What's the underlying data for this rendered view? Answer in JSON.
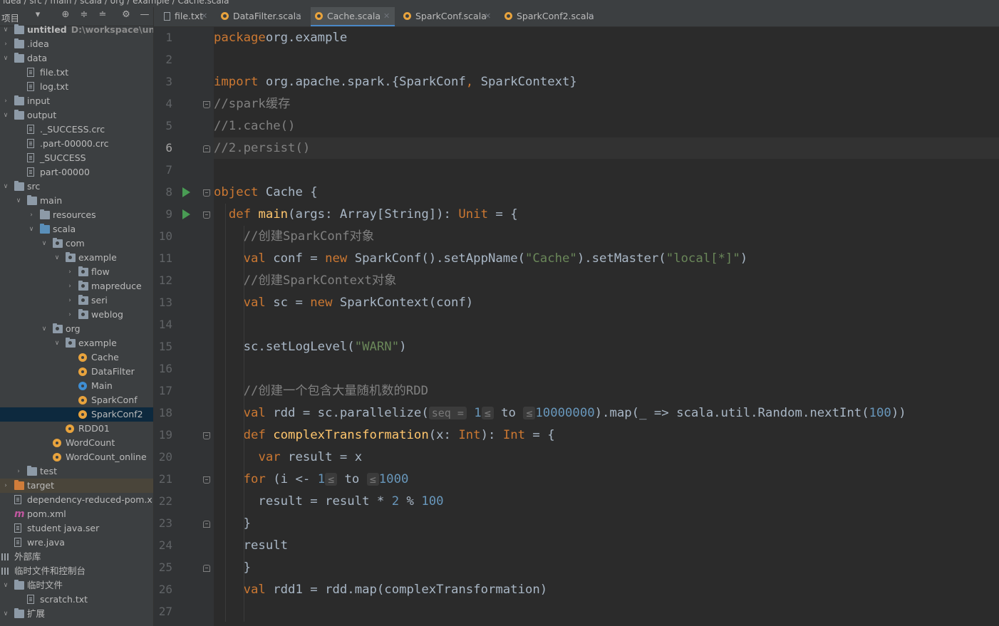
{
  "breadcrumb": "idea / src / main / scala / org / example / Cache.scala",
  "project_panel": {
    "title": "项目",
    "tree": [
      {
        "label": "untitled",
        "sub": "D:\\workspace\\untitled",
        "depth": 0,
        "arrow": "down",
        "icon": "folder",
        "bold": true
      },
      {
        "label": ".idea",
        "depth": 0,
        "arrow": "right",
        "icon": "folder"
      },
      {
        "label": "data",
        "depth": 0,
        "arrow": "down",
        "icon": "folder"
      },
      {
        "label": "file.txt",
        "depth": 1,
        "icon": "file"
      },
      {
        "label": "log.txt",
        "depth": 1,
        "icon": "file"
      },
      {
        "label": "input",
        "depth": 0,
        "arrow": "right",
        "icon": "folder"
      },
      {
        "label": "output",
        "depth": 0,
        "arrow": "down",
        "icon": "folder"
      },
      {
        "label": "._SUCCESS.crc",
        "depth": 1,
        "icon": "file"
      },
      {
        "label": ".part-00000.crc",
        "depth": 1,
        "icon": "file"
      },
      {
        "label": "_SUCCESS",
        "depth": 1,
        "icon": "file"
      },
      {
        "label": "part-00000",
        "depth": 1,
        "icon": "file"
      },
      {
        "label": "src",
        "depth": 0,
        "arrow": "down",
        "icon": "folder"
      },
      {
        "label": "main",
        "depth": 1,
        "arrow": "down",
        "icon": "folder"
      },
      {
        "label": "resources",
        "depth": 2,
        "arrow": "right",
        "icon": "folder"
      },
      {
        "label": "scala",
        "depth": 2,
        "arrow": "down",
        "icon": "folder-blue"
      },
      {
        "label": "com",
        "depth": 3,
        "arrow": "down",
        "icon": "package"
      },
      {
        "label": "example",
        "depth": 4,
        "arrow": "down",
        "icon": "package"
      },
      {
        "label": "flow",
        "depth": 5,
        "arrow": "right",
        "icon": "package"
      },
      {
        "label": "mapreduce",
        "depth": 5,
        "arrow": "right",
        "icon": "package"
      },
      {
        "label": "seri",
        "depth": 5,
        "arrow": "right",
        "icon": "package"
      },
      {
        "label": "weblog",
        "depth": 5,
        "arrow": "right",
        "icon": "package"
      },
      {
        "label": "org",
        "depth": 3,
        "arrow": "down",
        "icon": "package"
      },
      {
        "label": "example",
        "depth": 4,
        "arrow": "down",
        "icon": "package"
      },
      {
        "label": "Cache",
        "depth": 5,
        "icon": "scala-object"
      },
      {
        "label": "DataFilter",
        "depth": 5,
        "icon": "scala-object"
      },
      {
        "label": "Main",
        "depth": 5,
        "icon": "scala-class"
      },
      {
        "label": "SparkConf",
        "depth": 5,
        "icon": "scala-object"
      },
      {
        "label": "SparkConf2",
        "depth": 5,
        "icon": "scala-object",
        "selected": true
      },
      {
        "label": "RDD01",
        "depth": 4,
        "icon": "scala-object"
      },
      {
        "label": "WordCount",
        "depth": 3,
        "icon": "scala-object"
      },
      {
        "label": "WordCount_online",
        "depth": 3,
        "icon": "scala-object"
      },
      {
        "label": "test",
        "depth": 1,
        "arrow": "right",
        "icon": "folder"
      },
      {
        "label": "target",
        "depth": 0,
        "arrow": "right",
        "icon": "folder-orange",
        "highlight": true
      },
      {
        "label": "dependency-reduced-pom.xml",
        "depth": 0,
        "icon": "xml"
      },
      {
        "label": "pom.xml",
        "depth": 0,
        "icon": "maven"
      },
      {
        "label": "student java.ser",
        "depth": 0,
        "icon": "file"
      },
      {
        "label": "wre.java",
        "depth": 0,
        "icon": "file"
      },
      {
        "label": "外部库",
        "depth": -1,
        "icon": "library"
      },
      {
        "label": "临时文件和控制台",
        "depth": -1,
        "icon": "scratch"
      },
      {
        "label": "临时文件",
        "depth": 0,
        "arrow": "down",
        "icon": "folder"
      },
      {
        "label": "scratch.txt",
        "depth": 1,
        "icon": "file"
      },
      {
        "label": "扩展",
        "depth": 0,
        "arrow": "down",
        "icon": "folder"
      }
    ]
  },
  "tabs": [
    {
      "label": "file.txt",
      "icon": "file",
      "active": false
    },
    {
      "label": "DataFilter.scala",
      "icon": "scala",
      "active": false
    },
    {
      "label": "Cache.scala",
      "icon": "scala",
      "active": true
    },
    {
      "label": "SparkConf.scala",
      "icon": "scala",
      "active": false
    },
    {
      "label": "SparkConf2.scala",
      "icon": "scala",
      "active": false
    }
  ],
  "editor": {
    "current_line": 6,
    "lines": [
      [
        [
          "kw",
          "package"
        ],
        [
          "",
          "org.example"
        ]
      ],
      [],
      [
        [
          "kw",
          "import"
        ],
        [
          "",
          " org.apache.spark.{SparkConf"
        ],
        [
          "kw",
          ","
        ],
        [
          "",
          " SparkContext}"
        ]
      ],
      [
        [
          "cm",
          "//spark缓存"
        ]
      ],
      [
        [
          "cm",
          "//1.cache()"
        ]
      ],
      [
        [
          "cm",
          "//2.persist()"
        ]
      ],
      [],
      [
        [
          "kw",
          "object"
        ],
        [
          "",
          " Cache {"
        ]
      ],
      [
        [
          "",
          "  "
        ],
        [
          "kw",
          "def"
        ],
        [
          "",
          " "
        ],
        [
          "fn",
          "main"
        ],
        [
          "",
          "(args: Array[String]): "
        ],
        [
          "ty",
          "Unit"
        ],
        [
          "",
          " = {"
        ]
      ],
      [
        [
          "",
          "    "
        ],
        [
          "cm",
          "//创建SparkConf对象"
        ]
      ],
      [
        [
          "",
          "    "
        ],
        [
          "kw",
          "val"
        ],
        [
          "",
          " conf = "
        ],
        [
          "kw",
          "new"
        ],
        [
          "",
          " SparkConf().setAppName("
        ],
        [
          "str",
          "\"Cache\""
        ],
        [
          "",
          ").setMaster("
        ],
        [
          "str",
          "\"local[*]\""
        ],
        [
          "",
          ")"
        ]
      ],
      [
        [
          "",
          "    "
        ],
        [
          "cm",
          "//创建SparkContext对象"
        ]
      ],
      [
        [
          "",
          "    "
        ],
        [
          "kw",
          "val"
        ],
        [
          "",
          " sc = "
        ],
        [
          "kw",
          "new"
        ],
        [
          "",
          " SparkContext(conf)"
        ]
      ],
      [],
      [
        [
          "",
          "    sc.setLogLevel("
        ],
        [
          "str",
          "\"WARN\""
        ],
        [
          "",
          ")"
        ]
      ],
      [],
      [
        [
          "",
          "    "
        ],
        [
          "cm",
          "//创建一个包含大量随机数的RDD"
        ]
      ],
      [
        [
          "",
          "    "
        ],
        [
          "kw",
          "val"
        ],
        [
          "",
          " rdd = sc.parallelize("
        ],
        [
          "hint",
          "seq ="
        ],
        [
          "num",
          " 1"
        ],
        [
          "hint",
          "≤"
        ],
        [
          "",
          " to "
        ],
        [
          "hint",
          "≤"
        ],
        [
          "num",
          "10000000"
        ],
        [
          "",
          ").map(_ => scala.util.Random.nextInt("
        ],
        [
          "num",
          "100"
        ],
        [
          "",
          "))"
        ]
      ],
      [
        [
          "",
          "    "
        ],
        [
          "kw",
          "def"
        ],
        [
          "",
          " "
        ],
        [
          "fn",
          "complexTransformation"
        ],
        [
          "",
          "(x: "
        ],
        [
          "ty",
          "Int"
        ],
        [
          "",
          "): "
        ],
        [
          "ty",
          "Int"
        ],
        [
          "",
          " = {"
        ]
      ],
      [
        [
          "",
          "      "
        ],
        [
          "kw",
          "var"
        ],
        [
          "",
          " result = x"
        ]
      ],
      [
        [
          "",
          "    "
        ],
        [
          "kw",
          "for"
        ],
        [
          "",
          " (i <- "
        ],
        [
          "num",
          "1"
        ],
        [
          "hint",
          "≤"
        ],
        [
          "",
          " to "
        ],
        [
          "hint",
          "≤"
        ],
        [
          "num",
          "1000"
        ],
        [
          ") {"
        ]
      ],
      [
        [
          "",
          "      result = result * "
        ],
        [
          "num",
          "2"
        ],
        [
          "",
          " % "
        ],
        [
          "num",
          "100"
        ]
      ],
      [
        [
          "",
          "    }"
        ]
      ],
      [
        [
          "",
          "    result"
        ]
      ],
      [
        [
          "",
          "    }"
        ]
      ],
      [
        [
          "",
          "    "
        ],
        [
          "kw",
          "val"
        ],
        [
          "",
          " rdd1 = rdd.map(complexTransformation)"
        ]
      ],
      []
    ]
  },
  "gutter": {
    "run_lines": [
      8,
      9
    ],
    "fold_open_lines": [
      4,
      8,
      9,
      19,
      21
    ],
    "fold_close_lines": [
      6,
      23,
      25
    ]
  }
}
